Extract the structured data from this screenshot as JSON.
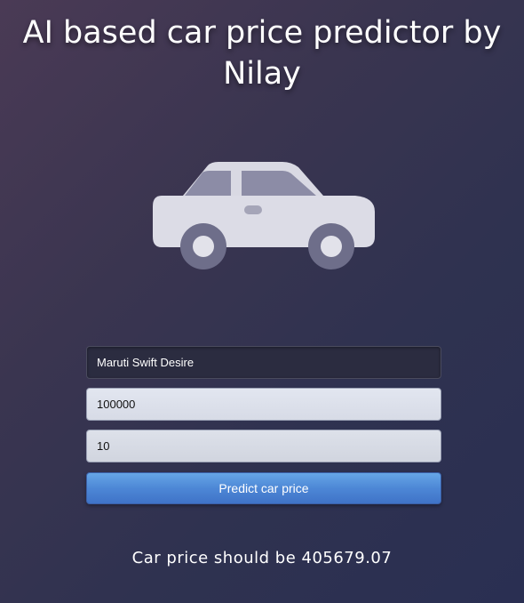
{
  "title": "AI based car price predictor by Nilay",
  "form": {
    "car_name_value": "Maruti Swift Desire",
    "kms_value": "100000",
    "years_value": "10",
    "submit_label": "Predict car price"
  },
  "result": {
    "text": "Car price should be 405679.07"
  },
  "colors": {
    "button": "#4d87d6",
    "background_start": "#4a3a55",
    "background_end": "#2a2f52"
  },
  "icons": {
    "illustration": "car-icon"
  }
}
